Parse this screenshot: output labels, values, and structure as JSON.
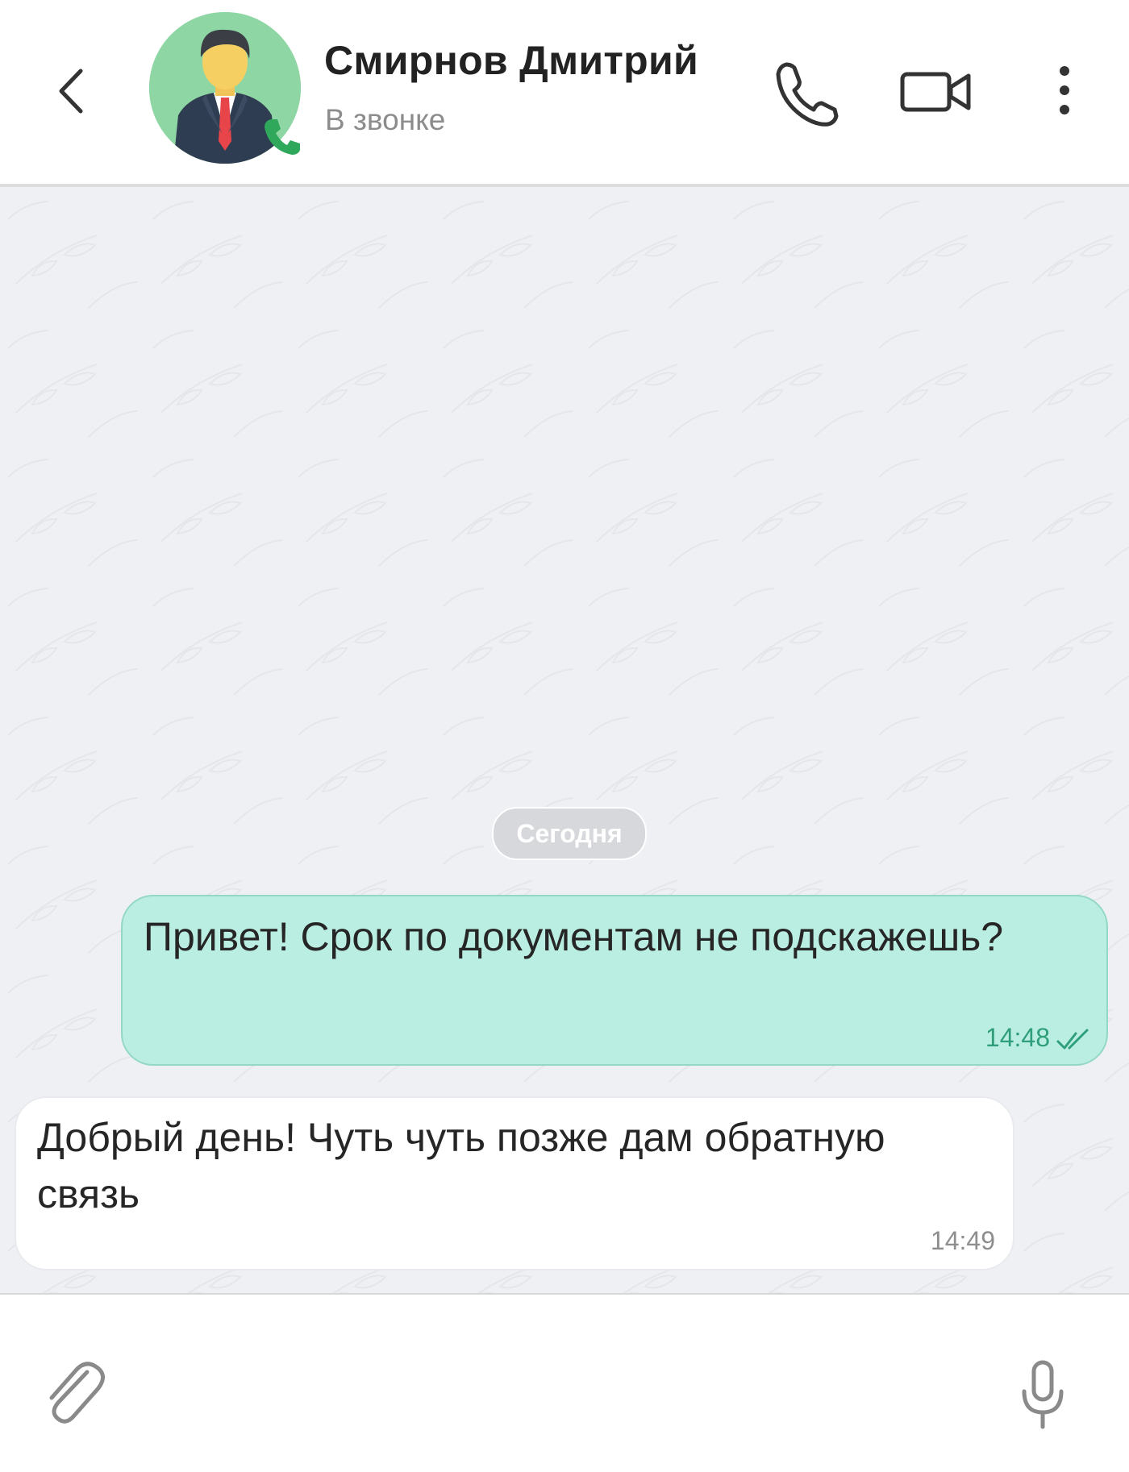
{
  "header": {
    "contact_name": "Смирнов Дмитрий",
    "contact_status": "В звонке",
    "icons": {
      "back": "chevron-left-icon",
      "avatar": "businessman-avatar",
      "badge": "phone-call-badge-icon",
      "voice_call": "phone-icon",
      "video_call": "video-camera-icon",
      "menu": "more-vertical-icon"
    }
  },
  "chat": {
    "date_separator": "Сегодня",
    "messages": [
      {
        "direction": "outgoing",
        "text": "Привет!  Срок по документам не подскажешь?",
        "time": "14:48",
        "status": "read"
      },
      {
        "direction": "incoming",
        "text": "Добрый день! Чуть чуть позже дам обратную связь",
        "time": "14:49"
      }
    ]
  },
  "input_bar": {
    "icons": {
      "attach": "paperclip-icon",
      "voice": "microphone-icon"
    }
  },
  "colors": {
    "accent_green": "#2f9e7a",
    "outgoing_bubble": "#bbeee2",
    "incoming_bubble": "#ffffff",
    "chat_background": "#eef0f4",
    "avatar_background": "#8ed6a3"
  }
}
